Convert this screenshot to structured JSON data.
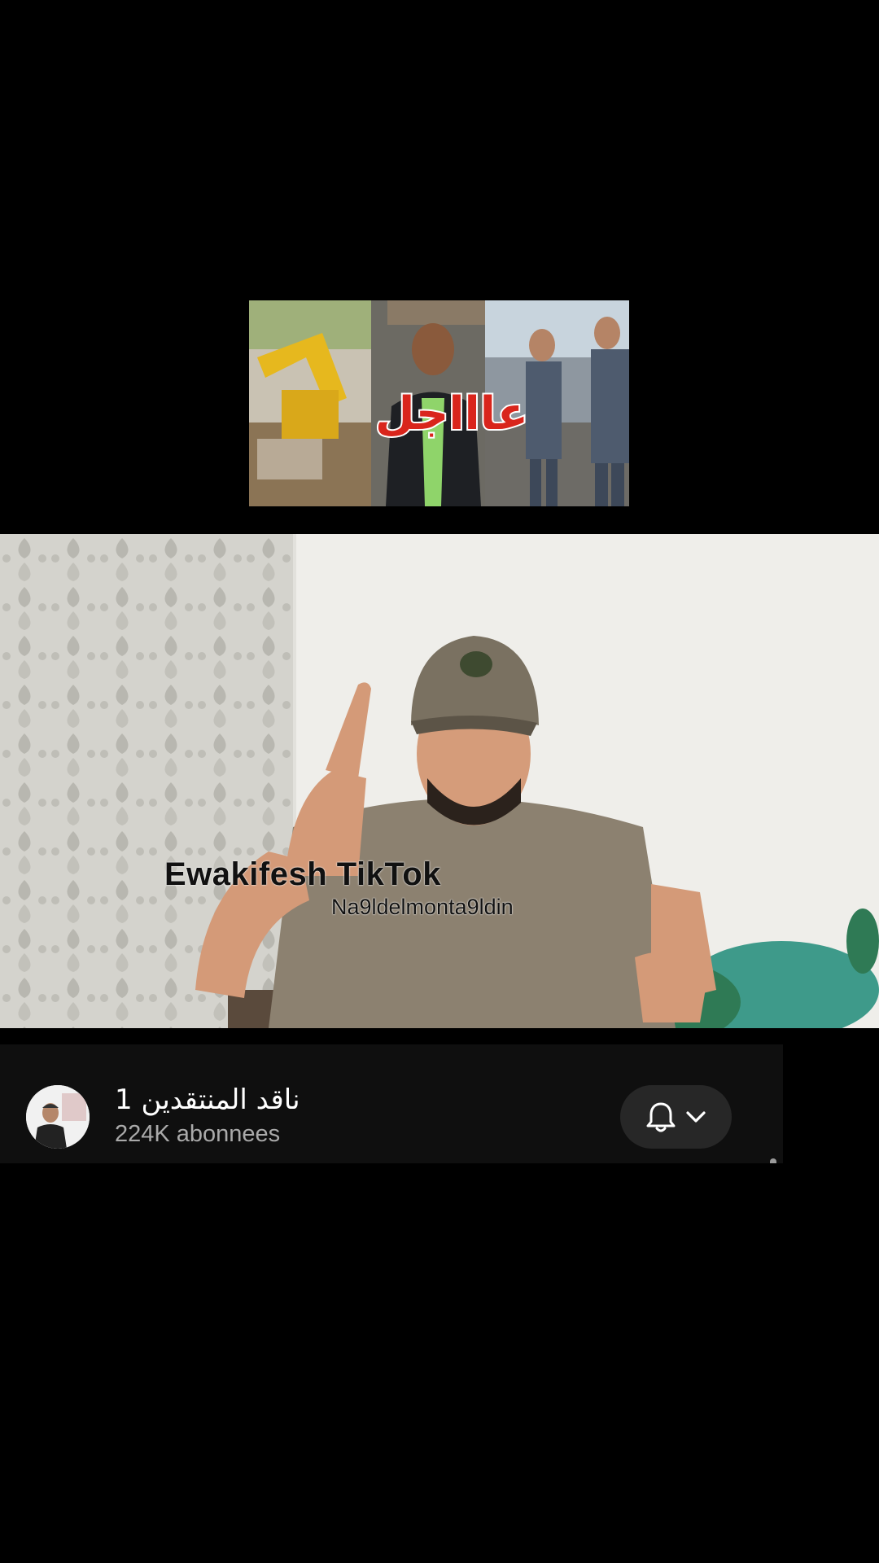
{
  "thumbnail": {
    "title_text": "عاااجل"
  },
  "video": {
    "watermark_main": "Ewakifesh TikTok",
    "watermark_sub": "Na9ldelmonta9ldin"
  },
  "channel": {
    "name": "ناقد المنتقدين 1",
    "subscribers": "224K abonnees",
    "notification_icon": "bell-icon",
    "dropdown_icon": "chevron-down-icon"
  },
  "colors": {
    "background": "#000000",
    "bar_background": "#0f0f0f",
    "button_background": "#272727",
    "secondary_text": "#aaaaaa",
    "thumbnail_title": "#d9251c"
  }
}
